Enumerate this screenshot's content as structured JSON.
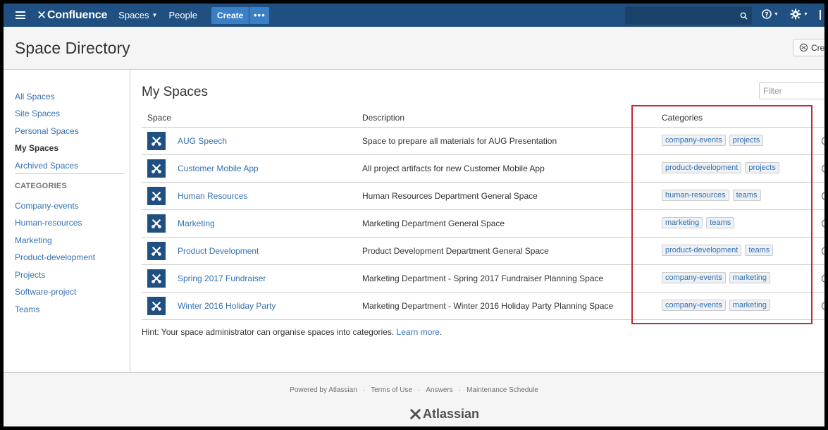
{
  "topnav": {
    "logo": "Confluence",
    "spaces_label": "Spaces",
    "people_label": "People",
    "create_label": "Create",
    "more_label": "•••"
  },
  "header": {
    "title": "Space Directory",
    "create_space_label": "Crea"
  },
  "sidebar": {
    "items": [
      "All Spaces",
      "Site Spaces",
      "Personal Spaces",
      "My Spaces",
      "Archived Spaces"
    ],
    "active_index": 3,
    "categories_heading": "CATEGORIES",
    "categories": [
      "Company-events",
      "Human-resources",
      "Marketing",
      "Product-development",
      "Projects",
      "Software-project",
      "Teams"
    ]
  },
  "main": {
    "title": "My Spaces",
    "filter_placeholder": "Filter",
    "columns": [
      "Space",
      "Description",
      "Categories"
    ],
    "rows": [
      {
        "name": "AUG Speech",
        "description": "Space to prepare all materials for AUG Presentation",
        "categories": [
          "company-events",
          "projects"
        ]
      },
      {
        "name": "Customer Mobile App",
        "description": "All project artifacts for new Customer Mobile App",
        "categories": [
          "product-development",
          "projects"
        ]
      },
      {
        "name": "Human Resources",
        "description": "Human Resources Department General Space",
        "categories": [
          "human-resources",
          "teams"
        ]
      },
      {
        "name": "Marketing",
        "description": "Marketing Department General Space",
        "categories": [
          "marketing",
          "teams"
        ]
      },
      {
        "name": "Product Development",
        "description": "Product Development Department General Space",
        "categories": [
          "product-development",
          "teams"
        ]
      },
      {
        "name": "Spring 2017 Fundraiser",
        "description": "Marketing Department - Spring 2017 Fundraiser Planning Space",
        "categories": [
          "company-events",
          "marketing"
        ]
      },
      {
        "name": "Winter 2016 Holiday Party",
        "description": "Marketing Department - Winter 2016 Holiday Party Planning Space",
        "categories": [
          "company-events",
          "marketing"
        ]
      }
    ],
    "hint_text": "Hint: Your space administrator can organise spaces into categories. ",
    "hint_link": "Learn more",
    "hint_end": "."
  },
  "footer": {
    "links": [
      "Powered by Atlassian",
      "Terms of Use",
      "Answers",
      "Maintenance Schedule"
    ],
    "separator": "·",
    "brand": "Atlassian"
  },
  "colors": {
    "nav": "#205081",
    "link": "#3572b0",
    "highlight": "#c8262d"
  }
}
